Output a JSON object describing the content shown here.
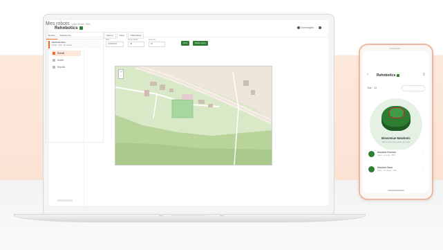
{
  "desktop": {
    "brand": "Rehnbotics",
    "header_user": "Dumregan",
    "sidebar": {
      "items": [
        {
          "label": "Rekisteröinti"
        },
        {
          "label": "Robotit"
        },
        {
          "label": "Alueet"
        },
        {
          "label": "Raportit"
        }
      ],
      "active_index": 1
    },
    "page": {
      "title": "Mes robots",
      "subtitle": "Lane Ahead Tech"
    },
    "list_panel": {
      "tabs": [
        "Robots",
        "Sélectionner"
      ],
      "items": [
        {
          "title": "Mowbotic Beta",
          "subtitle": "SN-01 · Actif · En service"
        }
      ]
    },
    "detail": {
      "tabs": [
        "Aperçu",
        "Carte",
        "Paramètres"
      ],
      "fields": [
        {
          "label": "Date",
          "value": "01/06/2024"
        },
        {
          "label": "Heure début",
          "value": "08"
        },
        {
          "label": "Heure fin",
          "value": "18"
        }
      ],
      "buttons": [
        "Zone",
        "Mettre à jour"
      ]
    },
    "map": {
      "zoom_in": "+",
      "zoom_out": "−",
      "colors": {
        "land": "#d9e8c6",
        "forest": "#b8d49b",
        "urban": "#eee6da",
        "pitch": "#a7d6a0",
        "road": "#f4eee4"
      }
    }
  },
  "mobile": {
    "brand": "Rehnbotics",
    "filter_label": "Tout",
    "filter_count": "12",
    "hero_title": "Bienvenue Mowbotic",
    "hero_subtitle": "Découvrez vos robots de tonte",
    "cards": [
      {
        "title": "Mowbotic Premium",
        "subtitle": "Statut : en tonte · 85%"
      },
      {
        "title": "Mowbotic Basic",
        "subtitle": "Statut : en charge · 40%"
      }
    ]
  }
}
